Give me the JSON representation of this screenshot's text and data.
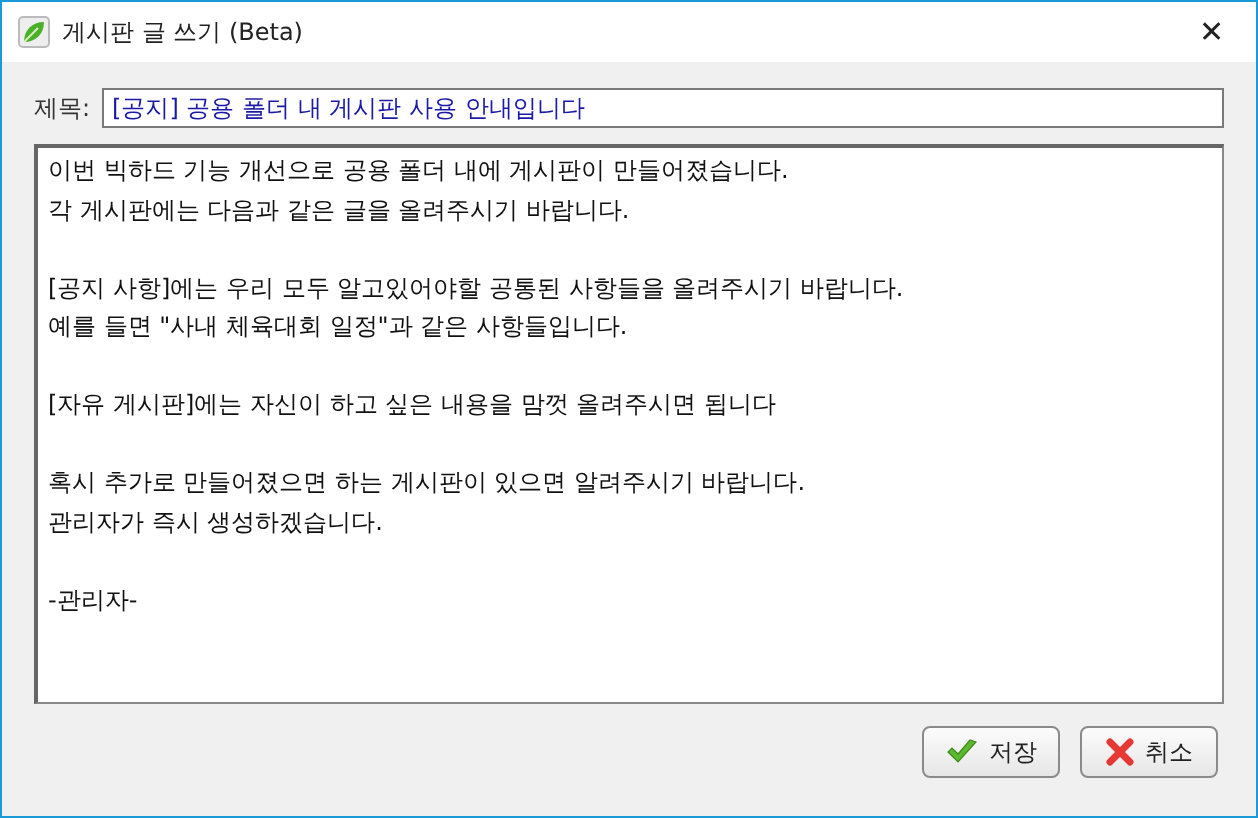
{
  "window": {
    "title": "게시판 글 쓰기 (Beta)",
    "close": "✕"
  },
  "subject": {
    "label": "제목:",
    "value": "[공지] 공용 폴더 내 게시판 사용 안내입니다"
  },
  "body": {
    "paragraphs": [
      [
        "이번 빅하드 기능 개선으로 공용 폴더 내에 게시판이 만들어졌습니다.",
        "각 게시판에는 다음과 같은 글을 올려주시기 바랍니다."
      ],
      [
        "[공지 사항]에는 우리 모두 알고있어야할 공통된 사항들을 올려주시기 바랍니다.",
        "예를 들면 \"사내 체육대회 일정\"과 같은 사항들입니다."
      ],
      [
        "[자유 게시판]에는 자신이 하고 싶은 내용을 맘껏 올려주시면 됩니다"
      ],
      [
        "혹시 추가로 만들어졌으면 하는 게시판이 있으면 알려주시기 바랍니다.",
        "관리자가 즉시 생성하겠습니다."
      ],
      [
        "-관리자-"
      ]
    ]
  },
  "buttons": [
    {
      "kind": "save",
      "label": "저장"
    },
    {
      "kind": "cancel",
      "label": "취소"
    }
  ]
}
